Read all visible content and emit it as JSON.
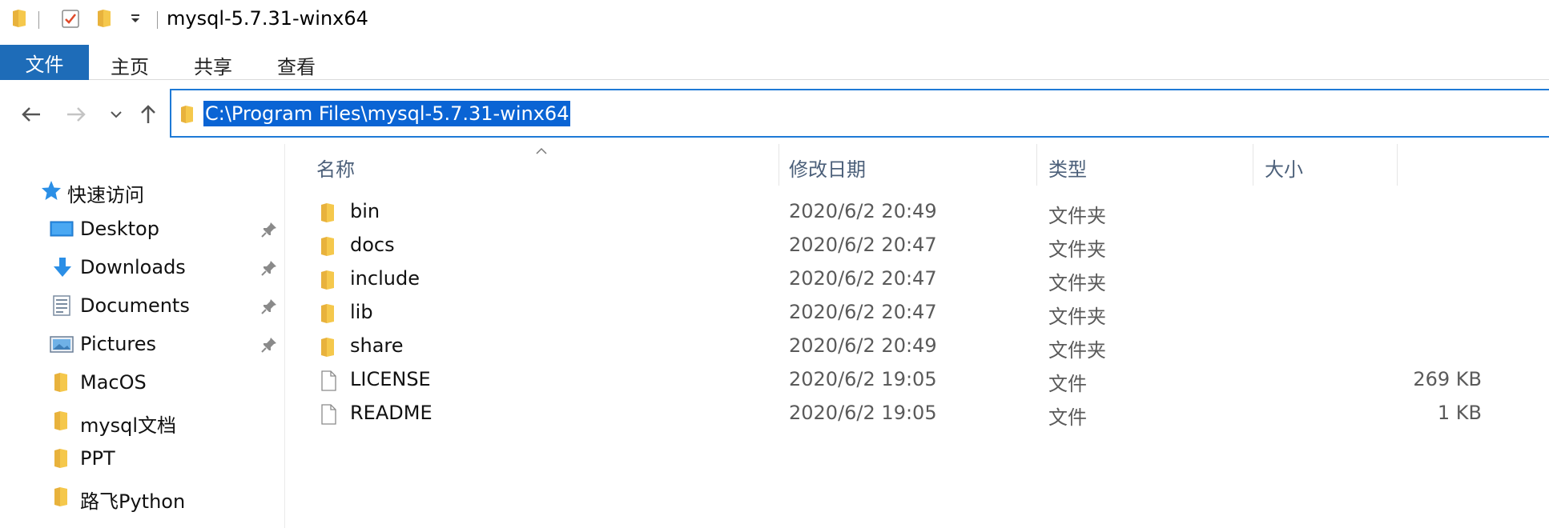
{
  "window": {
    "title": "mysql-5.7.31-winx64"
  },
  "ribbon": {
    "tabs": [
      {
        "label": "文件",
        "active": true
      },
      {
        "label": "主页",
        "active": false
      },
      {
        "label": "共享",
        "active": false
      },
      {
        "label": "查看",
        "active": false
      }
    ]
  },
  "address": {
    "path": "C:\\Program Files\\mysql-5.7.31-winx64"
  },
  "sidebar": {
    "quick_access": "快速访问",
    "items": [
      {
        "label": "Desktop",
        "icon": "desktop-icon",
        "pinned": true
      },
      {
        "label": "Downloads",
        "icon": "download-arrow-icon",
        "pinned": true
      },
      {
        "label": "Documents",
        "icon": "document-icon",
        "pinned": true
      },
      {
        "label": "Pictures",
        "icon": "pictures-icon",
        "pinned": true
      },
      {
        "label": "MacOS",
        "icon": "folder-icon",
        "pinned": false
      },
      {
        "label": "mysql文档",
        "icon": "folder-icon",
        "pinned": false
      },
      {
        "label": "PPT",
        "icon": "folder-icon",
        "pinned": false
      },
      {
        "label": "路飞Python",
        "icon": "folder-icon",
        "pinned": false
      }
    ]
  },
  "columns": {
    "name": "名称",
    "date": "修改日期",
    "type": "类型",
    "size": "大小"
  },
  "files": [
    {
      "name": "bin",
      "date": "2020/6/2 20:49",
      "type": "文件夹",
      "size": "",
      "icon": "folder-icon"
    },
    {
      "name": "docs",
      "date": "2020/6/2 20:47",
      "type": "文件夹",
      "size": "",
      "icon": "folder-icon"
    },
    {
      "name": "include",
      "date": "2020/6/2 20:47",
      "type": "文件夹",
      "size": "",
      "icon": "folder-icon"
    },
    {
      "name": "lib",
      "date": "2020/6/2 20:47",
      "type": "文件夹",
      "size": "",
      "icon": "folder-icon"
    },
    {
      "name": "share",
      "date": "2020/6/2 20:49",
      "type": "文件夹",
      "size": "",
      "icon": "folder-icon"
    },
    {
      "name": "LICENSE",
      "date": "2020/6/2 19:05",
      "type": "文件",
      "size": "269 KB",
      "icon": "file-icon"
    },
    {
      "name": "README",
      "date": "2020/6/2 19:05",
      "type": "文件",
      "size": "1 KB",
      "icon": "file-icon"
    }
  ],
  "colors": {
    "accent": "#1e6cb8",
    "selection": "#0a64d4",
    "folder": "#f5c84c",
    "header_text": "#4c607a"
  }
}
